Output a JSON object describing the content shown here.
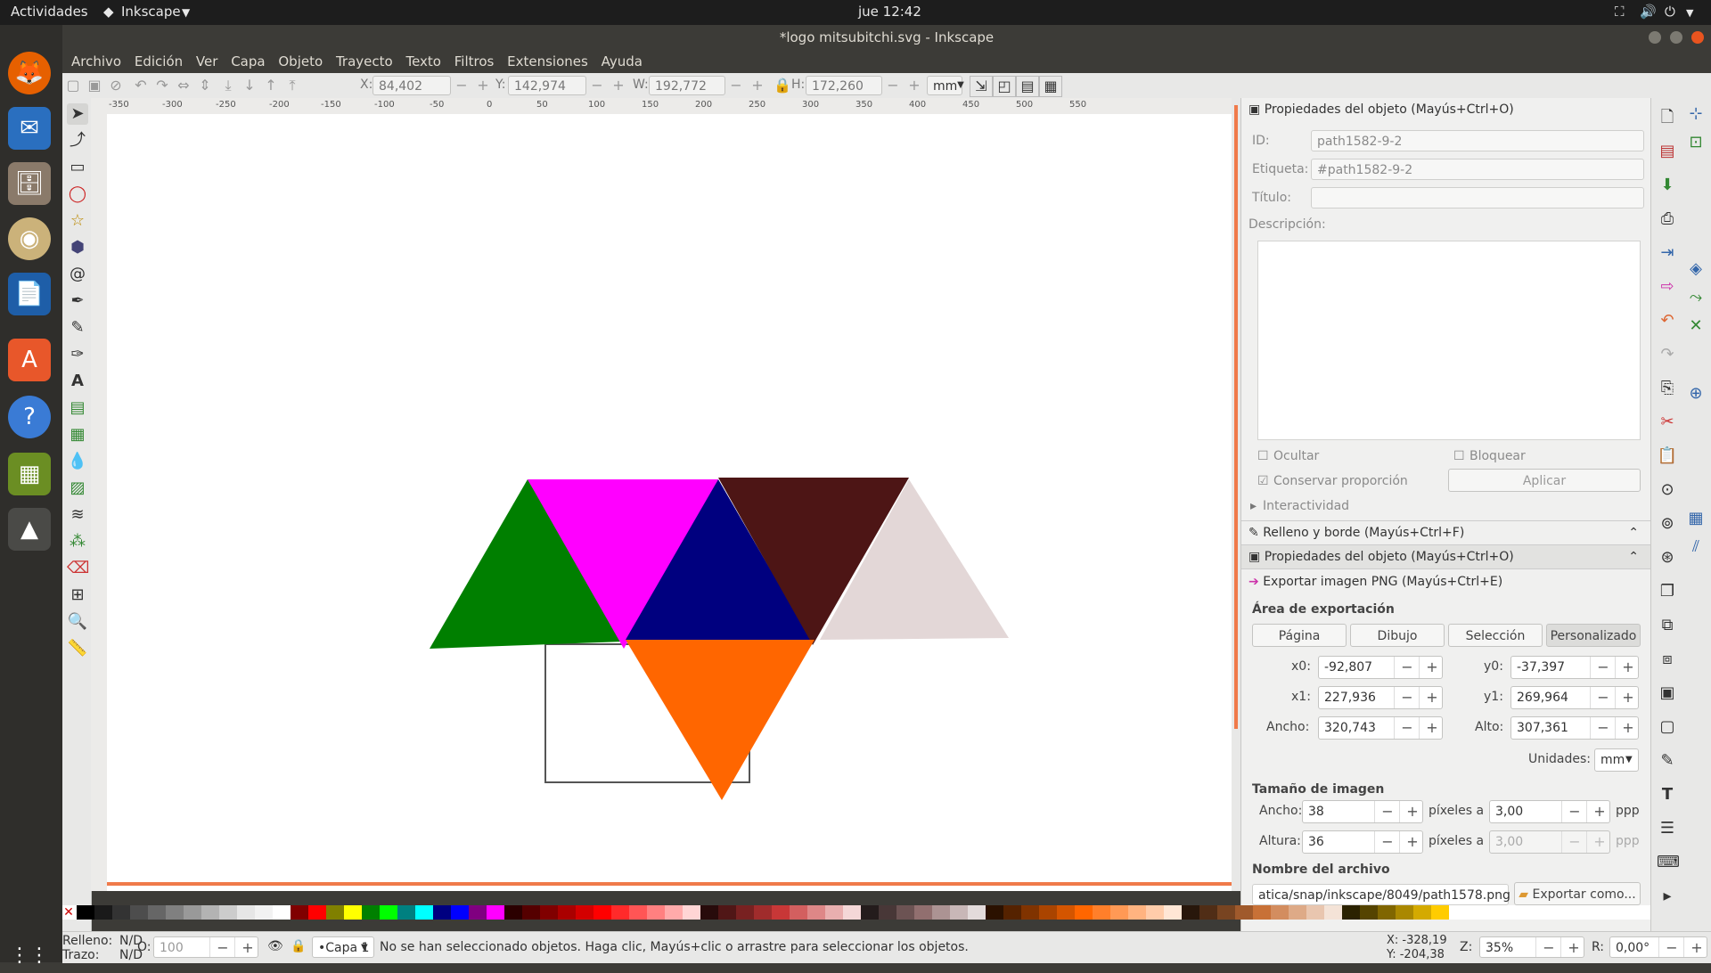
{
  "topbar": {
    "activities": "Actividades",
    "app": "Inkscape",
    "clock": "jue 12:42"
  },
  "window": {
    "title": "*logo mitsubitchi.svg - Inkscape"
  },
  "menu": [
    "Archivo",
    "Edición",
    "Ver",
    "Capa",
    "Objeto",
    "Trayecto",
    "Texto",
    "Filtros",
    "Extensiones",
    "Ayuda"
  ],
  "controls": {
    "x_label": "X:",
    "x_value": "84,402",
    "y_label": "Y:",
    "y_value": "142,974",
    "w_label": "W:",
    "w_value": "192,772",
    "h_label": "H:",
    "h_value": "172,260",
    "unit": "mm"
  },
  "ruler_ticks": [
    "-350",
    "-300",
    "-250",
    "-200",
    "-150",
    "-100",
    "-50",
    "0",
    "50",
    "100",
    "150",
    "200",
    "250",
    "300",
    "350",
    "400",
    "450",
    "500",
    "550"
  ],
  "canvas": {
    "triangles": [
      {
        "name": "green",
        "color": "#007f00"
      },
      {
        "name": "magenta",
        "color": "#ff00ff"
      },
      {
        "name": "navy",
        "color": "#00007f"
      },
      {
        "name": "maroon",
        "color": "#4d1515"
      },
      {
        "name": "light-pink",
        "color": "#e3d7d7"
      },
      {
        "name": "orange",
        "color": "#ff6600"
      }
    ]
  },
  "panel": {
    "obj_props_title": "Propiedades del objeto (Mayús+Ctrl+O)",
    "id_label": "ID:",
    "id_value": "path1582-9-2",
    "label_label": "Etiqueta:",
    "label_value": "#path1582-9-2",
    "title_label": "Título:",
    "title_value": "",
    "desc_label": "Descripción:",
    "hide_label": "Ocultar",
    "lock_label": "Bloquear",
    "keep_ratio_label": "Conservar proporción",
    "apply_label": "Aplicar",
    "interactivity_label": "Interactividad",
    "fill_stroke_title": "Relleno y borde (Mayús+Ctrl+F)",
    "obj_props_title2": "Propiedades del objeto (Mayús+Ctrl+O)",
    "export_title": "Exportar imagen PNG (Mayús+Ctrl+E)",
    "export_area_label": "Área de exportación",
    "area_buttons": [
      "Página",
      "Dibujo",
      "Selección",
      "Personalizado"
    ],
    "x0_label": "x0:",
    "x0": "-92,807",
    "y0_label": "y0:",
    "y0": "-37,397",
    "x1_label": "x1:",
    "x1": "227,936",
    "y1_label": "y1:",
    "y1": "269,964",
    "width_label": "Ancho:",
    "width": "320,743",
    "height_label": "Alto:",
    "height": "307,361",
    "units_label": "Unidades:",
    "units": "mm",
    "image_size_label": "Tamaño de imagen",
    "img_w_label": "Ancho:",
    "img_w": "38",
    "img_h_label": "Altura:",
    "img_h": "36",
    "px_at": "píxeles a",
    "dpi": "3,00",
    "dpi2": "3,00",
    "ppp": "ppp",
    "filename_label": "Nombre del archivo",
    "filename": "atica/snap/inkscape/8049/path1578.png",
    "export_as": "Exportar como..."
  },
  "status": {
    "fill_label": "Relleno:",
    "fill_value": "N/D",
    "stroke_label": "Trazo:",
    "stroke_value": "N/D",
    "opacity_label": "O:",
    "opacity_value": "100",
    "layer": "•Capa 1",
    "message": "No se han seleccionado objetos. Haga clic, Mayús+clic o arrastre para seleccionar los objetos.",
    "cursor_x": "X: -328,19",
    "cursor_y": "Y: -204,38",
    "zoom_label": "Z:",
    "zoom": "35%",
    "rot_label": "R:",
    "rotation": "0,00°"
  },
  "palette_colors": [
    "#000000",
    "#1a1a1a",
    "#333333",
    "#4d4d4d",
    "#666666",
    "#808080",
    "#999999",
    "#b3b3b3",
    "#cccccc",
    "#e6e6e6",
    "#f2f2f2",
    "#ffffff",
    "#800000",
    "#ff0000",
    "#808000",
    "#ffff00",
    "#008000",
    "#00ff00",
    "#008080",
    "#00ffff",
    "#000080",
    "#0000ff",
    "#800080",
    "#ff00ff",
    "#2b0000",
    "#550000",
    "#800000",
    "#aa0000",
    "#d40000",
    "#ff0000",
    "#ff2a2a",
    "#ff5555",
    "#ff8080",
    "#ffaaaa",
    "#ffd5d5",
    "#280b0b",
    "#501616",
    "#782121",
    "#a02c2c",
    "#c83737",
    "#d35f5f",
    "#de8787",
    "#e9afaf",
    "#f4d7d7",
    "#241c1c",
    "#483737",
    "#6c5353",
    "#916f6f",
    "#ac9393",
    "#c8b7b7",
    "#e3dbdb",
    "#2b1100",
    "#552200",
    "#803300",
    "#aa4400",
    "#d45500",
    "#ff6600",
    "#ff7f2a",
    "#ff9955",
    "#ffb380",
    "#ffccaa",
    "#ffe6d5",
    "#28170b",
    "#502d16",
    "#784421",
    "#a05a2c",
    "#c87137",
    "#d38d5f",
    "#deaa87",
    "#e9c6af",
    "#f4e3d7",
    "#2b2200",
    "#554400",
    "#806600",
    "#aa8800",
    "#d4aa00",
    "#ffcc00"
  ]
}
